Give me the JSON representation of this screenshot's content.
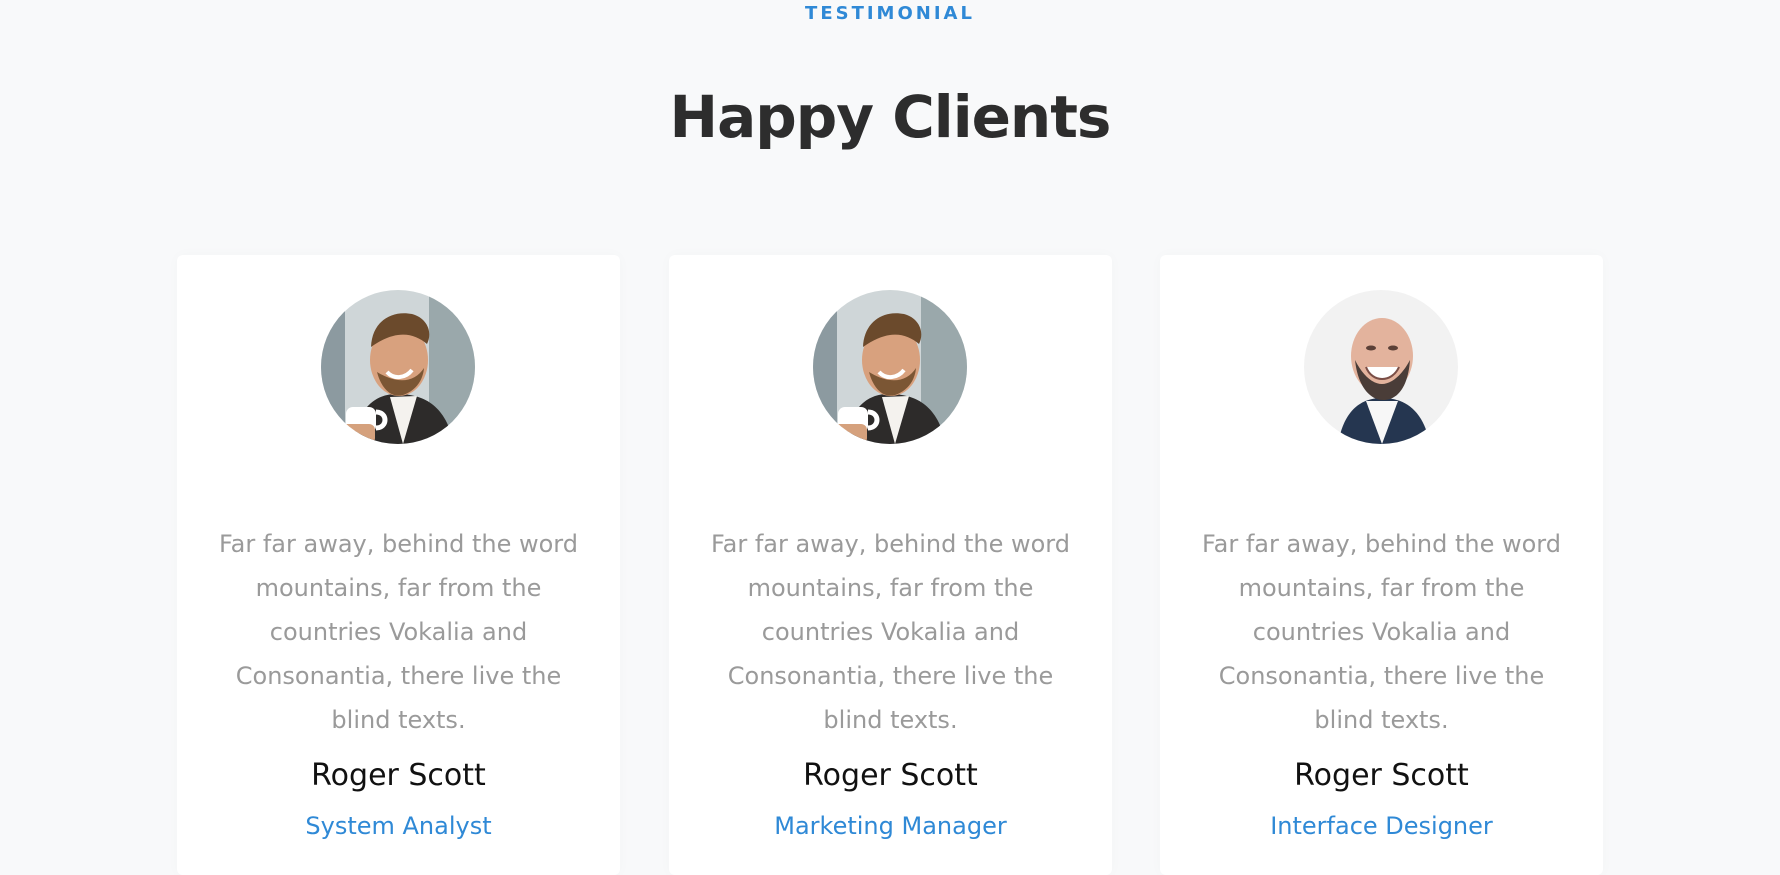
{
  "section": {
    "eyebrow": "TESTIMONIAL",
    "title": "Happy Clients"
  },
  "testimonials": [
    {
      "quote": "Far far away, behind the word mountains, far from the countries Vokalia and Consonantia, there live the blind texts.",
      "name": "Roger Scott",
      "role": "System Analyst",
      "avatar": "coffee-man-avatar"
    },
    {
      "quote": "Far far away, behind the word mountains, far from the countries Vokalia and Consonantia, there live the blind texts.",
      "name": "Roger Scott",
      "role": "Marketing Manager",
      "avatar": "coffee-man-avatar"
    },
    {
      "quote": "Far far away, behind the word mountains, far from the countries Vokalia and Consonantia, there live the blind texts.",
      "name": "Roger Scott",
      "role": "Interface Designer",
      "avatar": "bald-man-avatar"
    }
  ],
  "colors": {
    "accent": "#2f89d6",
    "background": "#f8f9fa",
    "title": "#2d2d2d",
    "quote": "#9a9a9a"
  }
}
